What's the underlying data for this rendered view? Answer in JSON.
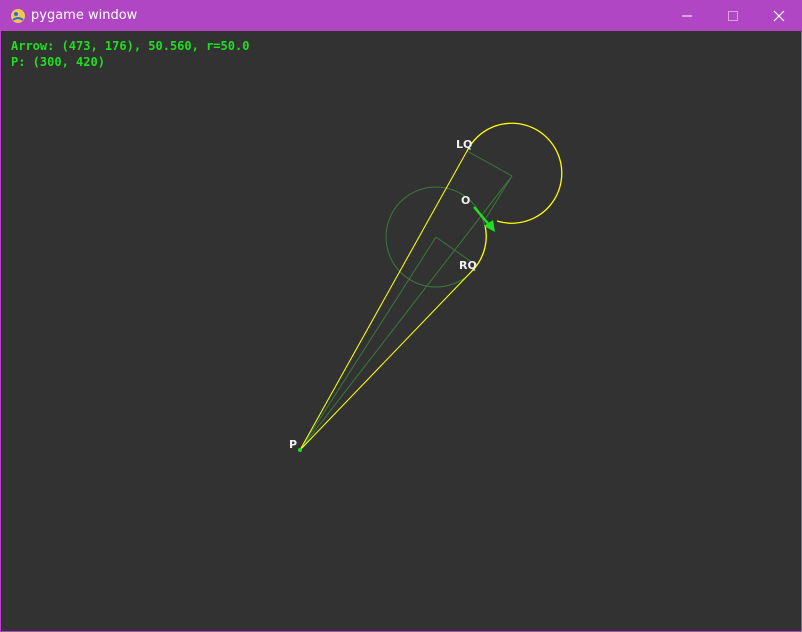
{
  "window": {
    "title": "pygame window",
    "app_icon": "pygame-snake-icon",
    "controls": {
      "minimize_icon": "minimize-icon",
      "maximize_icon": "maximize-icon",
      "close_icon": "close-icon"
    }
  },
  "hud": {
    "arrow_line": "Arrow: (473, 176), 50.560, r=50.0",
    "p_line": "P: (300, 420)"
  },
  "scene": {
    "labels": {
      "lq": "LQ",
      "o": "O",
      "rq": "RQ",
      "p": "P"
    }
  },
  "colors": {
    "titlebar": "#b046c4",
    "canvas": "#323232",
    "hud_text": "#1ee01e",
    "tangent": "#ffff00",
    "guide": "#3c783c",
    "arrow": "#1ee01e",
    "label": "#f0f0f0"
  }
}
